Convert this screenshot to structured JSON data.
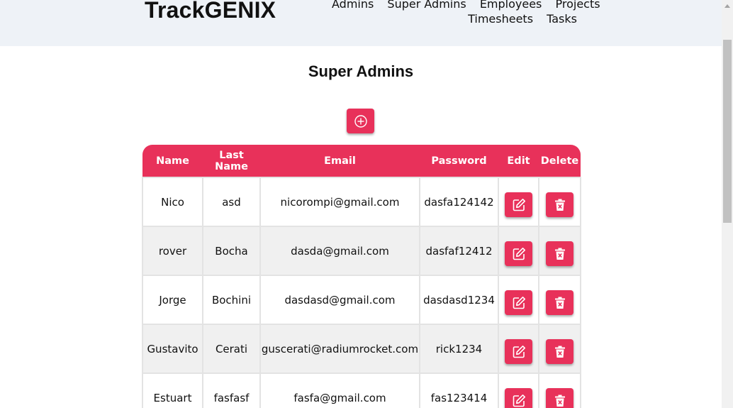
{
  "header": {
    "brand": "TrackGENIX",
    "nav_row1": [
      "Admins",
      "Super Admins",
      "Employees",
      "Projects"
    ],
    "nav_row2": [
      "Timesheets",
      "Tasks"
    ]
  },
  "page": {
    "title": "Super Admins",
    "add_icon": "plus-circle-icon"
  },
  "table": {
    "columns": [
      "Name",
      "Last Name",
      "Email",
      "Password",
      "Edit",
      "Delete"
    ],
    "rows": [
      {
        "name": "Nico",
        "last_name": "asd",
        "email": "nicorompi@gmail.com",
        "password": "dasfa124142"
      },
      {
        "name": "rover",
        "last_name": "Bocha",
        "email": "dasda@gmail.com",
        "password": "dasfaf12412"
      },
      {
        "name": "Jorge",
        "last_name": "Bochini",
        "email": "dasdasd@gmail.com",
        "password": "dasdasd1234"
      },
      {
        "name": "Gustavito",
        "last_name": "Cerati",
        "email": "guscerati@radiumrocket.com",
        "password": "rick1234"
      },
      {
        "name": "Estuart",
        "last_name": "fasfasf",
        "email": "fasfa@gmail.com",
        "password": "fas123414"
      }
    ],
    "edit_icon": "edit-icon",
    "delete_icon": "trash-icon"
  },
  "colors": {
    "accent": "#e8315a",
    "header_bg": "#eef2f7"
  }
}
